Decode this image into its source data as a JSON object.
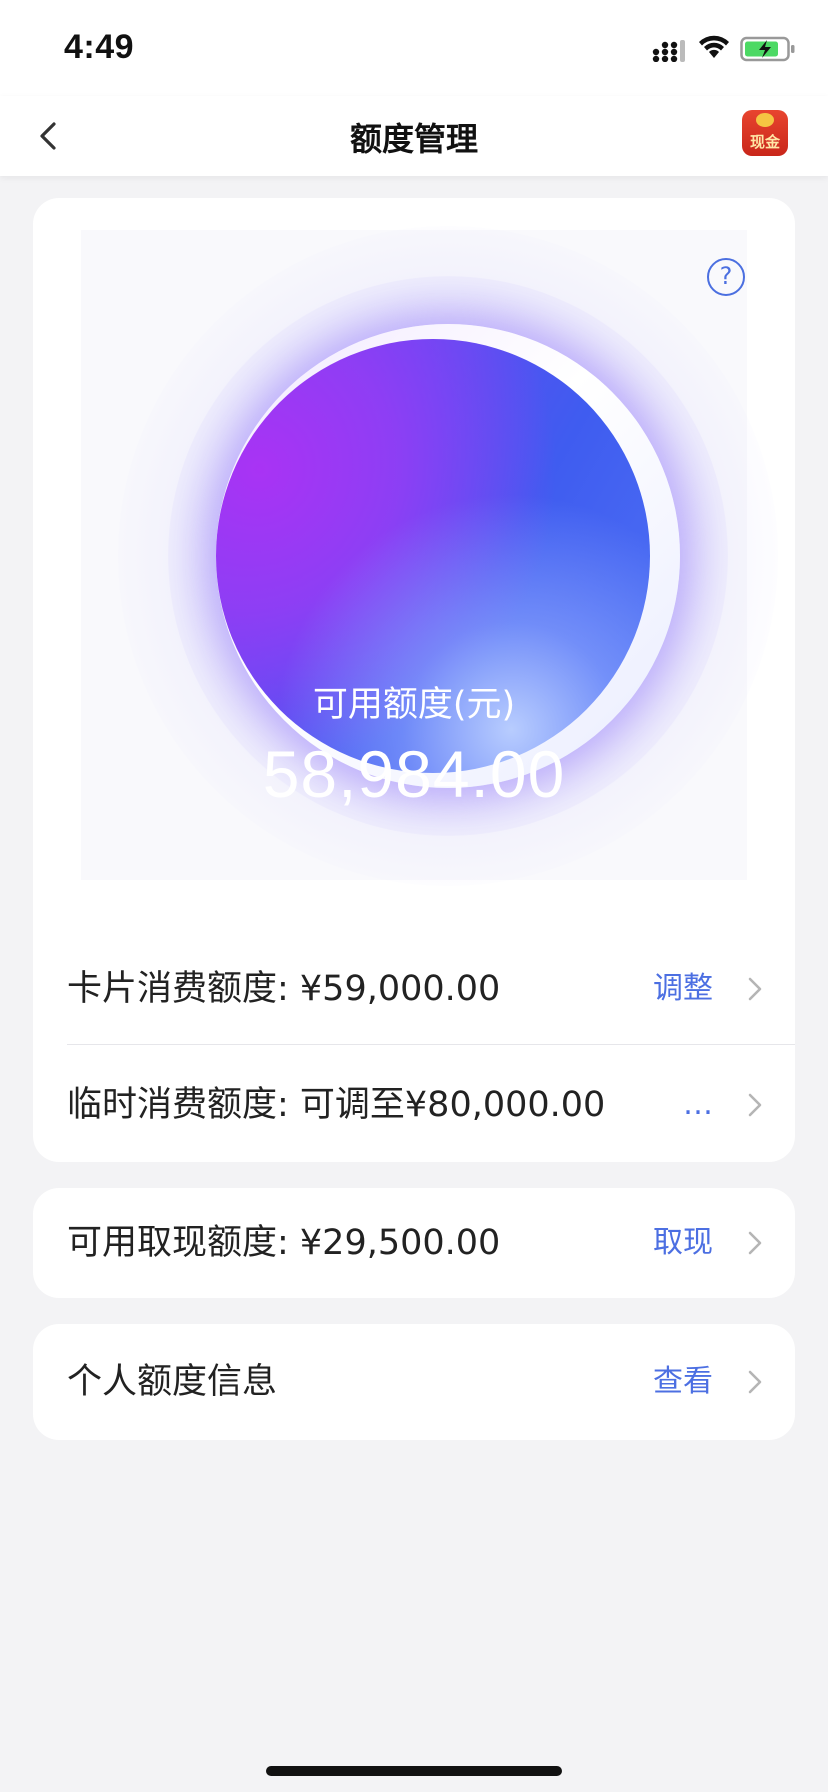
{
  "status_bar": {
    "time": "4:49",
    "icons": [
      "signal-icon",
      "wifi-icon",
      "battery-charging-icon"
    ]
  },
  "nav": {
    "title": "额度管理",
    "back_icon": "chevron-left-icon",
    "cash_badge_label": "现金"
  },
  "credit": {
    "available_label": "可用额度(元)",
    "available_value": "58,984.00",
    "help_symbol": "?"
  },
  "rows": {
    "card_limit": {
      "label": "卡片消费额度:  ¥59,000.00",
      "action": "调整"
    },
    "temp_limit": {
      "label": "临时消费额度: 可调至¥80,000.00",
      "action": "…"
    },
    "cash_limit": {
      "label": "可用取现额度:  ¥29,500.00",
      "action": "取现"
    },
    "personal_info": {
      "label": "个人额度信息",
      "action": "查看"
    }
  },
  "colors": {
    "accent": "#4c6fe2",
    "orb_purple": "#a933f4",
    "orb_blue": "#3f5cf0",
    "background": "#f3f3f5"
  }
}
